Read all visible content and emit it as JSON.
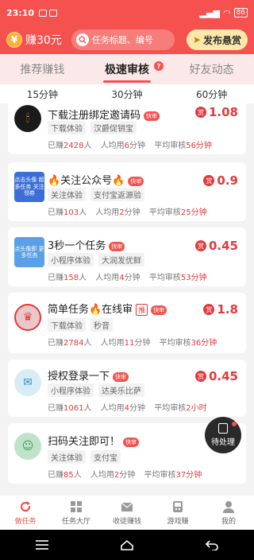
{
  "status_bar": {
    "time": "23:10",
    "battery": "86"
  },
  "header": {
    "balance": "赚30元",
    "coin_symbol": "¥",
    "search_placeholder": "任务标题、编号",
    "publish_label": "发布悬赏"
  },
  "main_tabs": [
    {
      "label": "推荐赚钱",
      "active": false
    },
    {
      "label": "极速审核",
      "active": true
    },
    {
      "label": "好友动态",
      "active": false
    }
  ],
  "sub_tabs": [
    {
      "label": "15分钟",
      "active": true
    },
    {
      "label": "30分钟",
      "active": false
    },
    {
      "label": "60分钟",
      "active": false
    }
  ],
  "tasks": [
    {
      "title": "下载注册绑定邀请码",
      "tags": [
        "下载体验",
        "汉爵促销宝"
      ],
      "earned": "2428",
      "avg_time": "6",
      "avg_review": "56分钟",
      "reward": "1.08",
      "avatar_text": "",
      "badge": "快审"
    },
    {
      "title": "🔥关注公众号🔥",
      "tags": [
        "关注体验",
        "支付宝返源验"
      ],
      "earned": "103",
      "avg_time": "2",
      "avg_review": "25分钟",
      "reward": "0.9",
      "avatar_text": "点击头像 超多任务 关注领券",
      "badge": "快审"
    },
    {
      "title": "3秒一个任务",
      "tags": [
        "小程序体验",
        "大润发优鲜"
      ],
      "earned": "158",
      "avg_time": "4",
      "avg_review": "53分钟",
      "reward": "0.45",
      "avatar_text": "点头像即 更多任务",
      "badge": "快审"
    },
    {
      "title": "简单任务🔥在线审",
      "tags": [
        "下载体验",
        "秒音"
      ],
      "earned": "2784",
      "avg_time": "11",
      "avg_review": "36分钟",
      "reward": "1.8",
      "avatar_text": "",
      "badge": "快审",
      "tui": "推"
    },
    {
      "title": "授权登录一下",
      "tags": [
        "小程序体验",
        "达美乐比萨"
      ],
      "earned": "1061",
      "avg_time": "4",
      "avg_review": "2小时",
      "reward": "0.45",
      "avatar_text": "",
      "badge": "快审"
    },
    {
      "title": "扫码关注即可！",
      "tags": [
        "关注体验",
        "支付宝"
      ],
      "earned": "85",
      "avg_time": "2",
      "avg_review": "37分钟",
      "reward": "",
      "avatar_text": "",
      "badge": "快审"
    }
  ],
  "labels": {
    "earned_prefix": "已赚",
    "earned_suffix": "人",
    "avg_time_prefix": "人均用",
    "avg_time_suffix": "分钟",
    "avg_review_prefix": "平均审核",
    "reward_icon": "赏"
  },
  "pending_label": "待处理",
  "bottom_nav": [
    {
      "label": "做任务",
      "icon": "refresh-icon",
      "active": true
    },
    {
      "label": "任务大厅",
      "icon": "grid-icon",
      "active": false
    },
    {
      "label": "收徒赚钱",
      "icon": "envelope-icon",
      "active": false
    },
    {
      "label": "游戏赚",
      "icon": "gamepad-icon",
      "active": false
    },
    {
      "label": "我的",
      "icon": "user-icon",
      "active": false
    }
  ],
  "colors": {
    "accent": "#f5524f",
    "reward": "#e4393c",
    "tab_bg": "#fbe9e9"
  }
}
